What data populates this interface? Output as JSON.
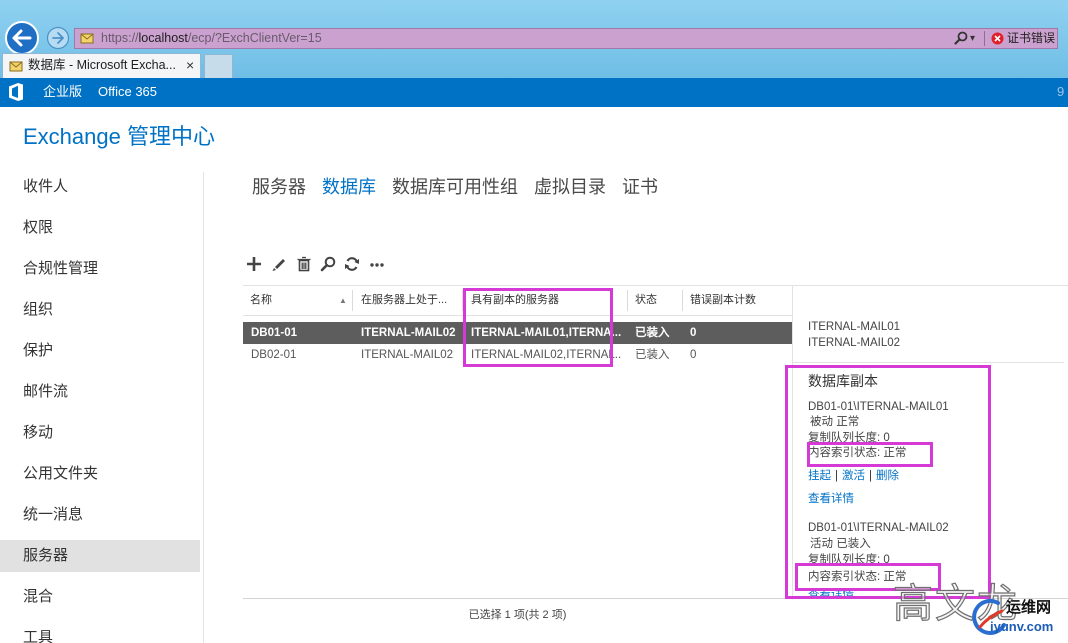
{
  "browser": {
    "url": {
      "scheme": "https://",
      "host": "localhost",
      "path": "/ecp/?ExchClientVer=15"
    },
    "search_dropdown": "▾",
    "cert_error": "证书错误",
    "tab": {
      "title": "数据库 - Microsoft Excha...",
      "close": "×"
    },
    "icons": [
      "back-arrow-icon",
      "forward-arrow-icon",
      "page-favicon-icon",
      "search-icon",
      "cert-error-icon"
    ]
  },
  "suite_bar": {
    "edition": "企业版",
    "product": "Office 365",
    "right_partial": "9",
    "icon": "office-logo-icon"
  },
  "app": {
    "title": "Exchange 管理中心"
  },
  "nav": {
    "items": [
      {
        "label": "收件人",
        "selected": false
      },
      {
        "label": "权限",
        "selected": false
      },
      {
        "label": "合规性管理",
        "selected": false
      },
      {
        "label": "组织",
        "selected": false
      },
      {
        "label": "保护",
        "selected": false
      },
      {
        "label": "邮件流",
        "selected": false
      },
      {
        "label": "移动",
        "selected": false
      },
      {
        "label": "公用文件夹",
        "selected": false
      },
      {
        "label": "统一消息",
        "selected": false
      },
      {
        "label": "服务器",
        "selected": true
      },
      {
        "label": "混合",
        "selected": false
      },
      {
        "label": "工具",
        "selected": false
      }
    ]
  },
  "tabs": {
    "items": [
      {
        "label": "服务器",
        "selected": false
      },
      {
        "label": "数据库",
        "selected": true
      },
      {
        "label": "数据库可用性组",
        "selected": false
      },
      {
        "label": "虚拟目录",
        "selected": false
      },
      {
        "label": "证书",
        "selected": false
      }
    ]
  },
  "toolbar": {
    "icons": [
      "add-icon",
      "edit-icon",
      "delete-icon",
      "search-icon",
      "refresh-icon",
      "more-icon"
    ]
  },
  "table": {
    "columns": [
      "名称",
      "在服务器上处于...",
      "具有副本的服务器",
      "状态",
      "错误副本计数"
    ],
    "sort_indicator": "▲",
    "rows": [
      {
        "name": "DB01-01",
        "active_on": "ITERNAL-MAIL02",
        "servers": "ITERNAL-MAIL01,ITERNA...",
        "status": "已装入",
        "bad_copies": "0",
        "selected": true
      },
      {
        "name": "DB02-01",
        "active_on": "ITERNAL-MAIL02",
        "servers": "ITERNAL-MAIL02,ITERNAL...",
        "status": "已装入",
        "bad_copies": "0",
        "selected": false
      }
    ]
  },
  "details": {
    "servers": [
      "ITERNAL-MAIL01",
      "ITERNAL-MAIL02"
    ],
    "copies_heading": "数据库副本",
    "separator": "|",
    "copies": [
      {
        "name": "DB01-01\\ITERNAL-MAIL01",
        "state": "被动 正常",
        "queue": "复制队列长度: 0",
        "index": "内容索引状态: 正常",
        "actions": [
          "挂起",
          "激活",
          "删除"
        ],
        "details_link": "查看详情"
      },
      {
        "name": "DB01-01\\ITERNAL-MAIL02",
        "state": "活动 已装入",
        "queue": "复制队列长度: 0",
        "index": "内容索引状态: 正常",
        "details_link": "查看详情"
      }
    ]
  },
  "footer": {
    "selection": "已选择 1 项(共 2 项)"
  },
  "watermark": {
    "author": "高文龙",
    "site_name": "运维网",
    "site_url": "iyunv.com"
  },
  "colors": {
    "accent": "#0072c6",
    "selected_row": "#5d5d5d",
    "selected_nav": "#e1e1e1",
    "annotation": "#d63ad6"
  }
}
